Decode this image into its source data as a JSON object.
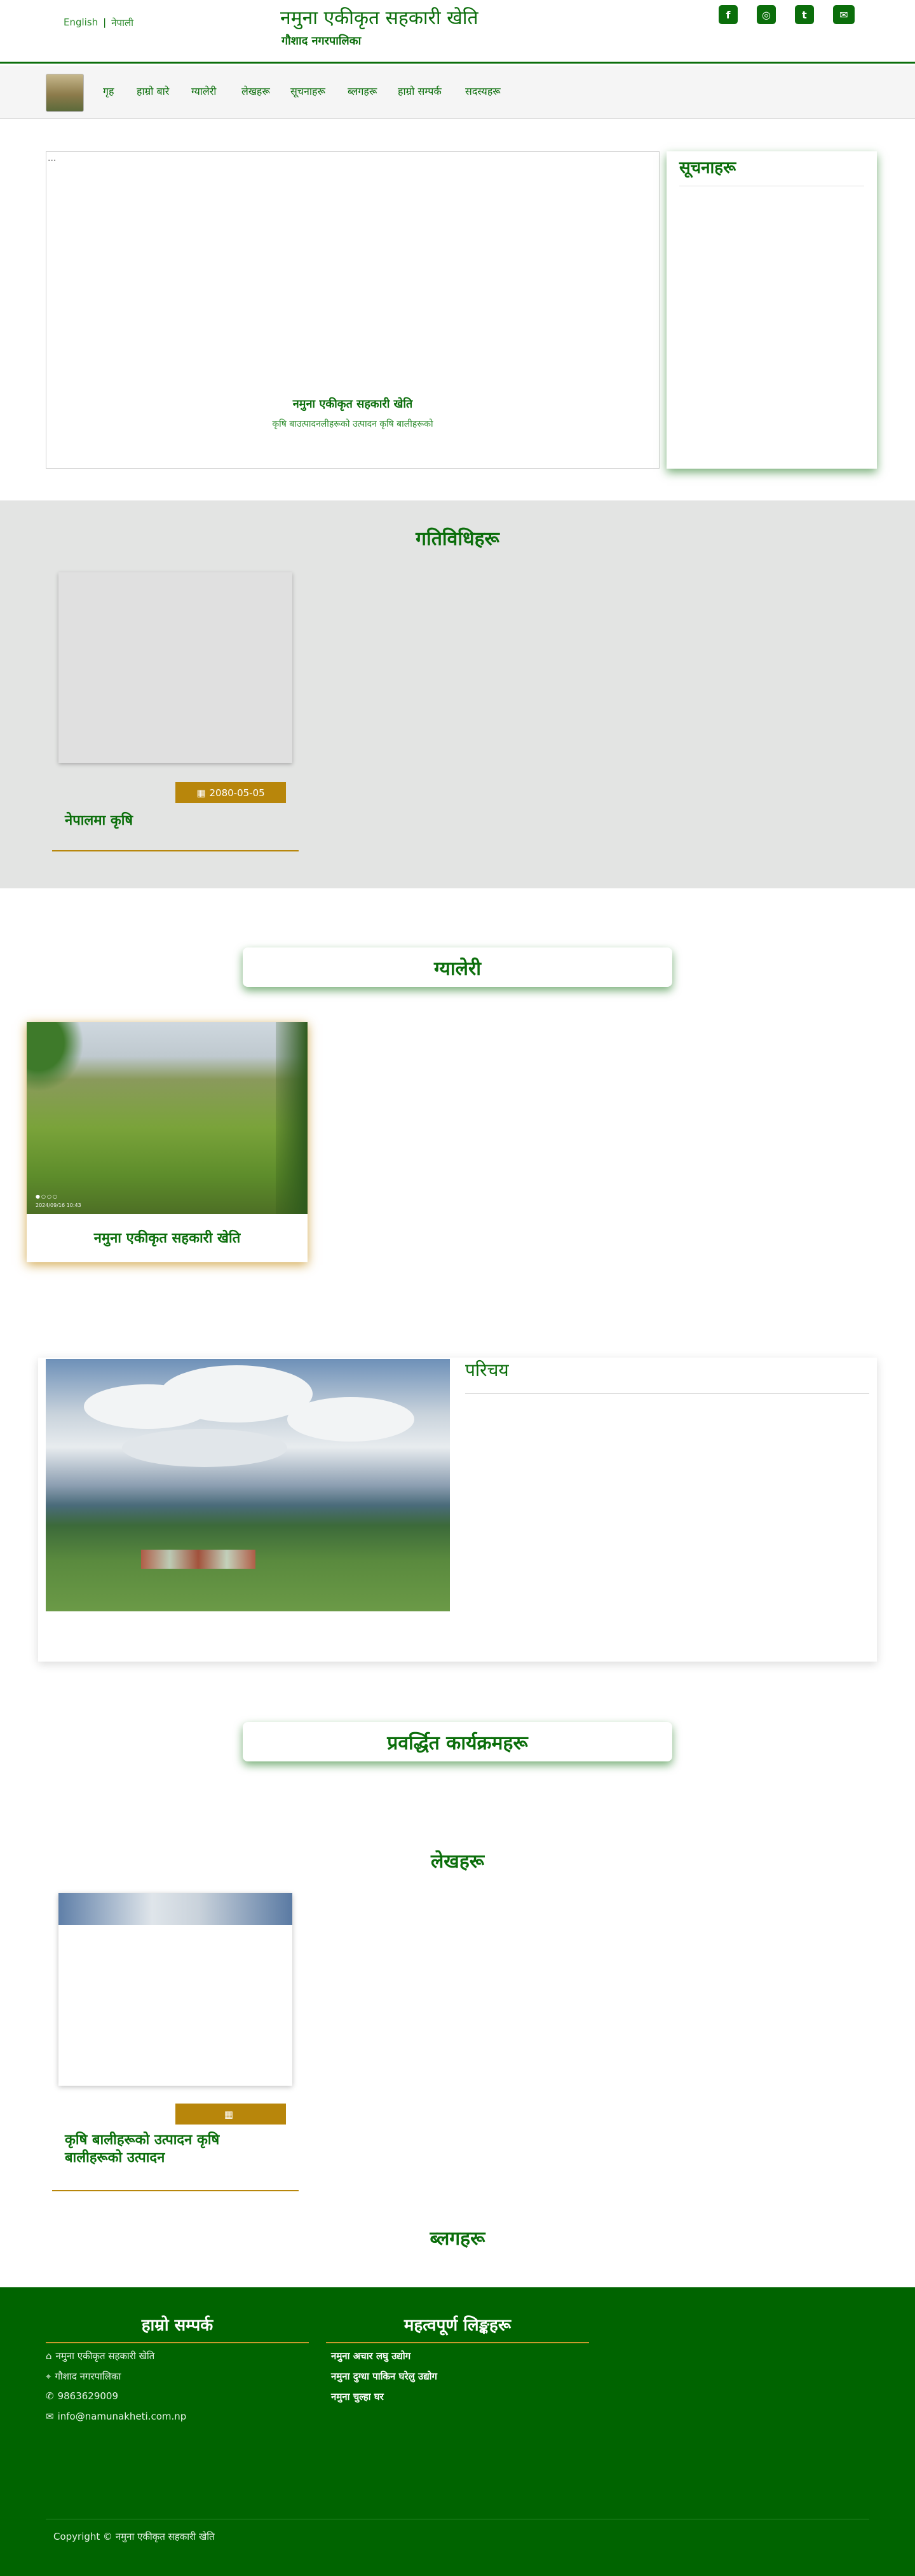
{
  "header": {
    "lang_en": "English",
    "lang_sep": "|",
    "lang_ne": "नेपाली",
    "title": "नमुना एकीकृत सहकारी खेति",
    "subtitle": "गौशाद नगरपालिका",
    "social_icons": [
      "facebook-icon",
      "instagram-icon",
      "twitter-icon",
      "envelope-icon"
    ],
    "social_glyphs": [
      "f",
      "◎",
      "t",
      "✉"
    ]
  },
  "nav": {
    "items": [
      "गृह",
      "हाम्रो बारे",
      "ग्यालेरी",
      "लेखहरू",
      "सूचनाहरू",
      "ब्लगहरू",
      "हाम्रो सम्पर्क",
      "सदस्यहरू"
    ]
  },
  "hero": {
    "broken_alt": "...",
    "caption_title": "नमुना एकीकृत सहकारी खेति",
    "caption_sub": "कृषि बाउत्पादनलीहरूको उत्पादन कृषि बालीहरूको"
  },
  "notice": {
    "title": "सूचनाहरू"
  },
  "activities": {
    "title": "गतिविधिहरू",
    "card": {
      "date": "2080-05-05",
      "title": "नेपालमा कृषि"
    }
  },
  "gallery": {
    "title": "ग्यालेरी",
    "caption": "नमुना एकीकृत सहकारी खेति",
    "photo_dots": "●○○○",
    "photo_stamp": "2024/09/16 10:43"
  },
  "intro": {
    "title": "परिचय"
  },
  "programs": {
    "title": "प्रवर्द्धित कार्यक्रमहरू"
  },
  "articles": {
    "title": "लेखहरू",
    "card": {
      "date": "",
      "title_line1": "कृषि बालीहरूको उत्पादन कृषि",
      "title_line2": "बालीहरूको उत्पादन"
    }
  },
  "blogs": {
    "title": "ब्लगहरू"
  },
  "footer": {
    "contact_title": "हाम्रो सम्पर्क",
    "contact": [
      {
        "icon": "home-icon",
        "glyph": "⌂",
        "text": "नमुना एकीकृत सहकारी खेति"
      },
      {
        "icon": "map-marker-icon",
        "glyph": "⌖",
        "text": "गौशाद नगरपालिका"
      },
      {
        "icon": "phone-icon",
        "glyph": "✆",
        "text": "9863629009"
      },
      {
        "icon": "envelope-icon",
        "glyph": "✉",
        "text": "info@namunakheti.com.np"
      }
    ],
    "links_title": "महत्वपूर्ण लिङ्कहरू",
    "links": [
      "नमुना अचार लघु उद्योग",
      "नमुना दुग्धा पाकिन घरेलु उद्योग",
      "नमुना चुल्हा घर"
    ],
    "copyright": "Copyright © नमुना एकीकृत सहकारी खेति"
  },
  "colors": {
    "primary": "#0b6e0b",
    "footer_bg": "#006400",
    "accent": "#b8860b",
    "section_bg": "#e3e4e3"
  }
}
